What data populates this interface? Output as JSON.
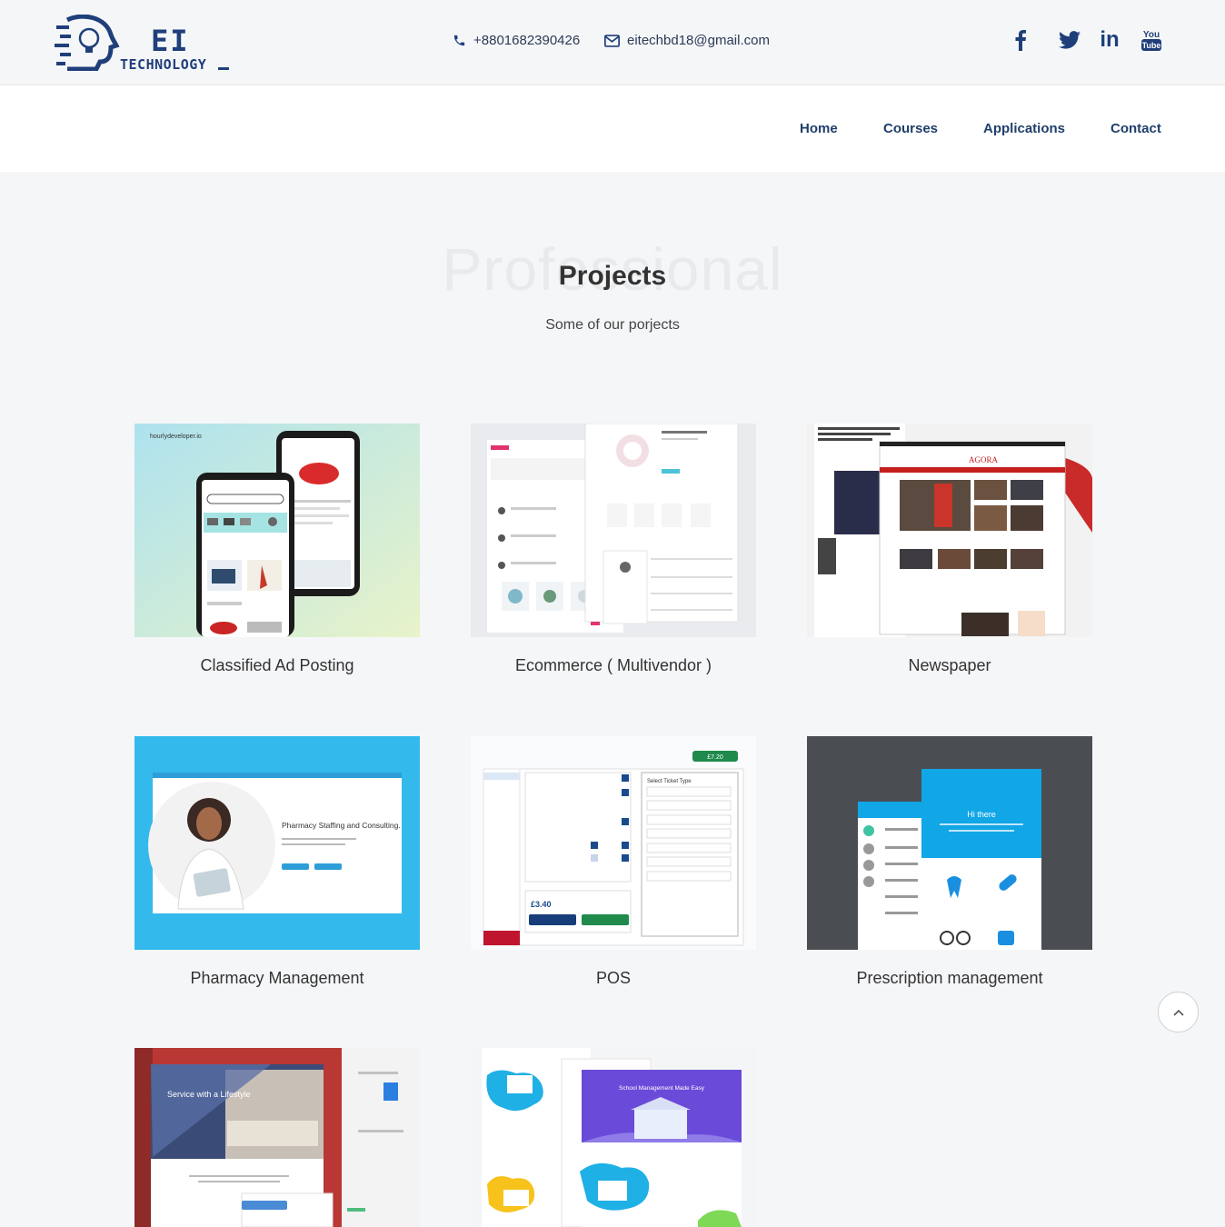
{
  "brand": {
    "name_top": "EI",
    "name_bottom": "TECHNOLOGY"
  },
  "contact": {
    "phone": "+8801682390426",
    "email": "eitechbd18@gmail.com"
  },
  "social": {
    "youtube_top": "You",
    "youtube_bottom": "Tube",
    "linkedin": "in"
  },
  "nav": {
    "home": "Home",
    "courses": "Courses",
    "applications": "Applications",
    "contact": "Contact"
  },
  "section": {
    "background_word": "Professional",
    "title": "Projects",
    "subtitle": "Some of our porjects"
  },
  "projects": [
    {
      "label": "Classified Ad Posting",
      "thumb_caption": "hourlydeveloper.io"
    },
    {
      "label": "Ecommerce ( Multivendor )"
    },
    {
      "label": "Newspaper",
      "thumb_brand": "AGORA"
    },
    {
      "label": "Pharmacy Management",
      "thumb_heading": "Pharmacy Staffing and Consulting."
    },
    {
      "label": "POS",
      "thumb_price": "£3.40",
      "thumb_total": "£7.20",
      "thumb_ticket_title": "Select Ticket Type"
    },
    {
      "label": "Prescription management",
      "thumb_greeting": "Hi there"
    },
    {
      "label": "",
      "thumb_heading": "Service with a Lifestyle"
    },
    {
      "label": "",
      "thumb_heading": "School Management Made Easy"
    }
  ],
  "colors": {
    "brand_navy": "#1f3f7a",
    "nav_text": "#1f3f6a",
    "page_bg": "#f5f6f8"
  }
}
